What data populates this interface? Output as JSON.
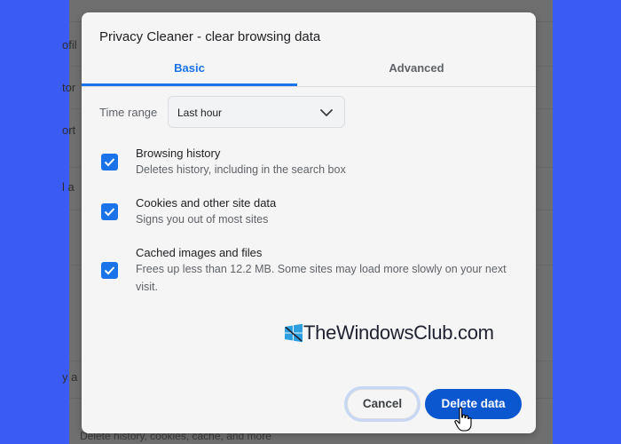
{
  "background": {
    "rows": [
      {
        "text": "ofil"
      },
      {
        "text": "tor"
      },
      {
        "text": "ort"
      },
      {
        "text": "l a"
      },
      {
        "text": "y a"
      },
      {
        "text": "Delete history, cookies, cache, and more"
      }
    ]
  },
  "dialog": {
    "title": "Privacy Cleaner - clear browsing data",
    "tabs": [
      {
        "label": "Basic",
        "active": true
      },
      {
        "label": "Advanced",
        "active": false
      }
    ],
    "time_range": {
      "label": "Time range",
      "value": "Last hour"
    },
    "options": [
      {
        "title": "Browsing history",
        "description": "Deletes history, including in the search box",
        "checked": true
      },
      {
        "title": "Cookies and other site data",
        "description": "Signs you out of most sites",
        "checked": true
      },
      {
        "title": "Cached images and files",
        "description": "Frees up less than 12.2 MB. Some sites may load more slowly on your next visit.",
        "checked": true
      }
    ],
    "buttons": {
      "cancel": "Cancel",
      "delete": "Delete data"
    }
  },
  "watermark": {
    "text": "TheWindowsClub.com"
  },
  "colors": {
    "accent": "#1a73e8",
    "primary_button": "#0b57d0",
    "outer_background": "#3b5bf5"
  },
  "icons": {
    "dropdown": "chevron-down-icon",
    "checkbox": "checkmark-icon",
    "cursor": "hand-pointer-icon"
  }
}
